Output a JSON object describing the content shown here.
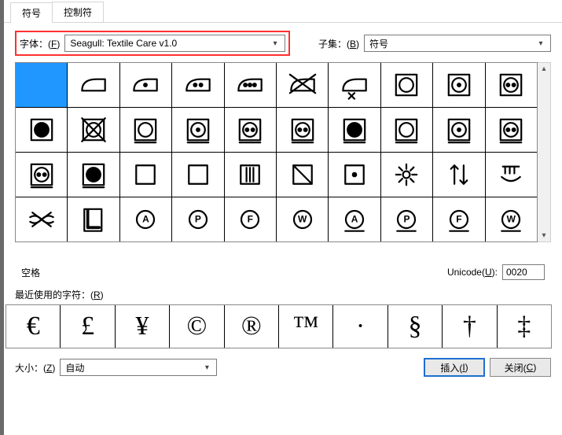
{
  "tabs": {
    "symbol": "符号",
    "control": "控制符"
  },
  "labels": {
    "font_prefix": "字体：(",
    "font_hot": "F",
    "font_suffix": ")",
    "subset_prefix": "子集：(",
    "subset_hot": "B",
    "subset_suffix": ")",
    "space": "空格",
    "unicode_prefix": "Unicode(",
    "unicode_hot": "U",
    "unicode_suffix": "):",
    "recent_prefix": "最近使用的字符：(",
    "recent_hot": "R",
    "recent_suffix": ")",
    "size_prefix": "大小：(",
    "size_hot": "Z",
    "size_suffix": ")",
    "insert_prefix": "插入(",
    "insert_hot": "I",
    "insert_suffix": ")",
    "close_prefix": "关闭(",
    "close_hot": "C",
    "close_suffix": ")"
  },
  "font_value": "Seagull: Textile Care v1.0",
  "subset_value": "符号",
  "unicode_value": "0020",
  "size_value": "自动",
  "recent": [
    "€",
    "£",
    "¥",
    "©",
    "®",
    "™",
    "·",
    "§",
    "†",
    "‡"
  ],
  "letters": {
    "A": "A",
    "P": "P",
    "F": "F",
    "W": "W"
  },
  "chart_data": {
    "type": "table",
    "title": "Symbol grid — Seagull: Textile Care v1.0",
    "columns": 10,
    "rows": 4,
    "selected_index": 0,
    "cells": [
      "blank-selected",
      "iron",
      "iron-1dot",
      "iron-2dot",
      "iron-3dot",
      "iron-cross",
      "iron-steam-cross",
      "tumble",
      "tumble-1dot",
      "tumble-2dot",
      "tumble-filled",
      "tumble-cross",
      "tumble-line",
      "tumble-1dot-line",
      "tumble-2dot-line",
      "tumble-2dot-line",
      "tumble-filled-line",
      "tumble-line",
      "tumble-1dot-line",
      "tumble-2dot-line",
      "tumble-2dot-line",
      "tumble-filled-line",
      "square",
      "square",
      "square-v3",
      "square-diag",
      "square-dot",
      "sun",
      "arrows-updown",
      "hand",
      "twist-cross",
      "square-L",
      "circle-A",
      "circle-P",
      "circle-F",
      "circle-W",
      "circle-A-u",
      "circle-P-u",
      "circle-F-u",
      "circle-W-u"
    ]
  }
}
